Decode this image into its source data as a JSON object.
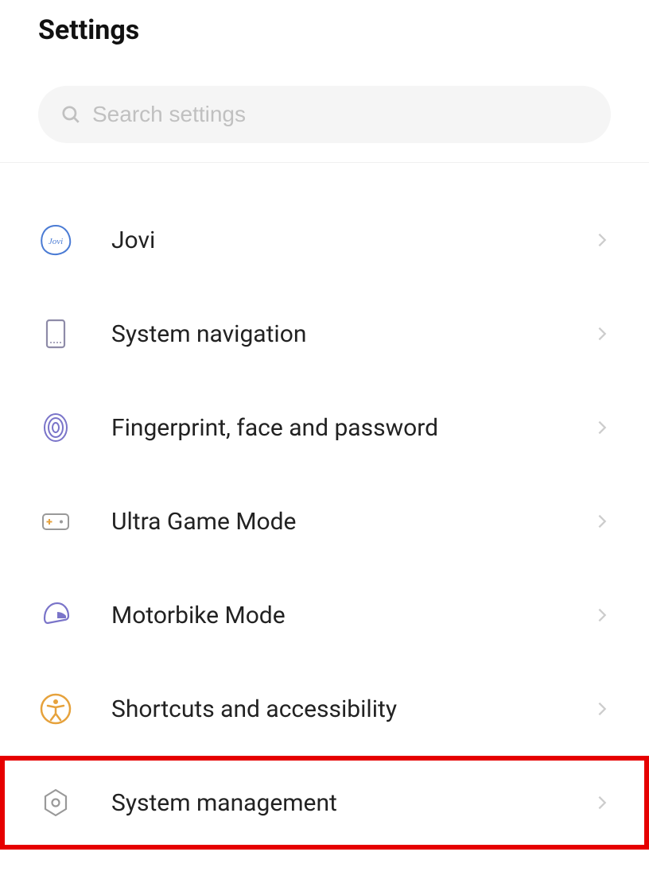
{
  "header": {
    "title": "Settings"
  },
  "search": {
    "placeholder": "Search settings"
  },
  "items": [
    {
      "label": "Jovi",
      "icon": "jovi"
    },
    {
      "label": "System navigation",
      "icon": "phone-nav"
    },
    {
      "label": "Fingerprint, face and password",
      "icon": "fingerprint"
    },
    {
      "label": "Ultra Game Mode",
      "icon": "gamepad"
    },
    {
      "label": "Motorbike Mode",
      "icon": "helmet"
    },
    {
      "label": "Shortcuts and accessibility",
      "icon": "accessibility"
    },
    {
      "label": "System management",
      "icon": "gear-hex"
    }
  ],
  "highlighted_index": 6
}
